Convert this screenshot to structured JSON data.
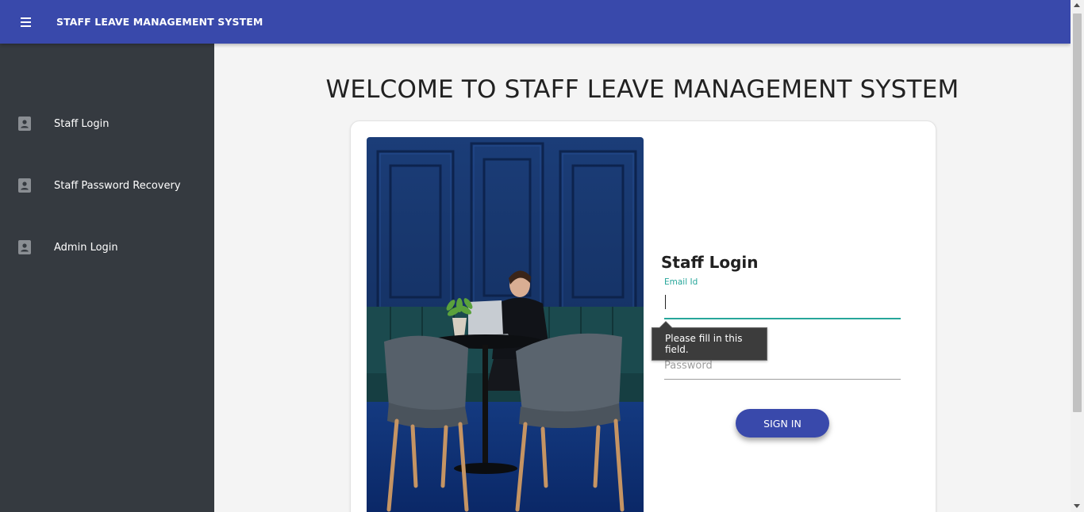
{
  "header": {
    "app_title": "STAFF LEAVE MANAGEMENT SYSTEM",
    "menu_icon": "hamburger-menu-icon",
    "accent_color": "#3949ab"
  },
  "sidebar": {
    "background_color": "#353a40",
    "items": [
      {
        "label": "Staff Login",
        "icon": "account-box-icon"
      },
      {
        "label": "Staff Password Recovery",
        "icon": "account-box-icon"
      },
      {
        "label": "Admin Login",
        "icon": "account-box-icon"
      }
    ]
  },
  "main": {
    "welcome_heading": "WELCOME TO STAFF LEAVE MANAGEMENT SYSTEM",
    "login_form": {
      "title": "Staff Login",
      "email_label": "Email Id",
      "email_value": "",
      "password_placeholder": "Password",
      "password_value": "",
      "validation_tooltip": "Please fill in this field.",
      "submit_label": "SIGN IN",
      "focus_color": "#26a69a"
    }
  }
}
